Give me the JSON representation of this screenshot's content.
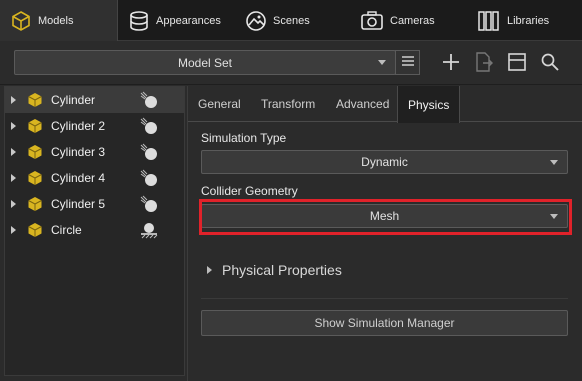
{
  "top_tabs": [
    {
      "label": "Models",
      "icon": "cube-icon",
      "active": true
    },
    {
      "label": "Appearances",
      "icon": "appearances-icon",
      "active": false
    },
    {
      "label": "Scenes",
      "icon": "scenes-icon",
      "active": false
    },
    {
      "label": "Cameras",
      "icon": "camera-icon",
      "active": false
    },
    {
      "label": "Libraries",
      "icon": "libraries-icon",
      "active": false
    }
  ],
  "toolbar": {
    "model_set": "Model Set",
    "icons": [
      "list-icon",
      "add-icon",
      "import-icon",
      "layout-icon",
      "search-icon"
    ]
  },
  "tree": {
    "items": [
      {
        "label": "Cylinder",
        "selected": true,
        "icon": "cube-icon",
        "sim_icon": "dynamic-sim-icon"
      },
      {
        "label": "Cylinder 2",
        "selected": false,
        "icon": "cube-icon",
        "sim_icon": "dynamic-sim-icon"
      },
      {
        "label": "Cylinder 3",
        "selected": false,
        "icon": "cube-icon",
        "sim_icon": "dynamic-sim-icon"
      },
      {
        "label": "Cylinder 4",
        "selected": false,
        "icon": "cube-icon",
        "sim_icon": "dynamic-sim-icon"
      },
      {
        "label": "Cylinder 5",
        "selected": false,
        "icon": "cube-icon",
        "sim_icon": "dynamic-sim-icon"
      },
      {
        "label": "Circle",
        "selected": false,
        "icon": "cube-icon",
        "sim_icon": "static-sim-icon"
      }
    ]
  },
  "panel": {
    "tabs": [
      {
        "label": "General",
        "active": false
      },
      {
        "label": "Transform",
        "active": false
      },
      {
        "label": "Advanced",
        "active": false
      },
      {
        "label": "Physics",
        "active": true
      }
    ],
    "simulation_type": {
      "label": "Simulation Type",
      "value": "Dynamic"
    },
    "collider_geometry": {
      "label": "Collider Geometry",
      "value": "Mesh"
    },
    "physical_properties": "Physical Properties",
    "show_sim_manager": "Show Simulation Manager"
  },
  "colors": {
    "accent_cube": "#d9b520",
    "highlight": "#e0222a"
  }
}
